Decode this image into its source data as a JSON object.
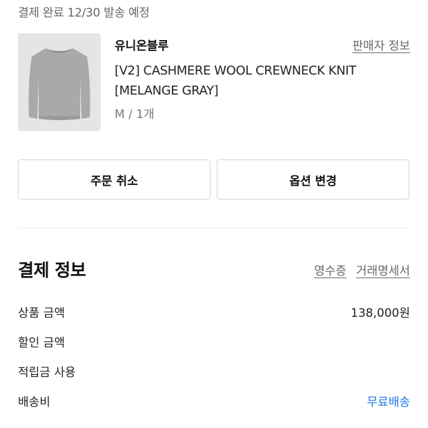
{
  "status": "결제 완료 12/30 발송 예정",
  "product": {
    "brand": "유니온블루",
    "seller_link": "판매자 정보",
    "name": "[V2] CASHMERE WOOL CREWNECK KNIT [MELANGE GRAY]",
    "option": "M / 1개",
    "image": "gray-crewneck-sweater-image"
  },
  "actions": {
    "cancel_label": "주문 취소",
    "change_option_label": "옵션 변경"
  },
  "payment": {
    "title": "결제 정보",
    "receipt_link": "영수증",
    "statement_link": "거래명세서",
    "rows": [
      {
        "label": "상품 금액",
        "value": "138,000원"
      },
      {
        "label": "할인 금액",
        "value": ""
      },
      {
        "label": "적립금 사용",
        "value": ""
      },
      {
        "label": "배송비",
        "value": "무료배송"
      }
    ]
  },
  "colors": {
    "accent_blue": "#1a73e8",
    "thumb_bg": "#e5e5e5",
    "border": "#d6d6d6"
  }
}
